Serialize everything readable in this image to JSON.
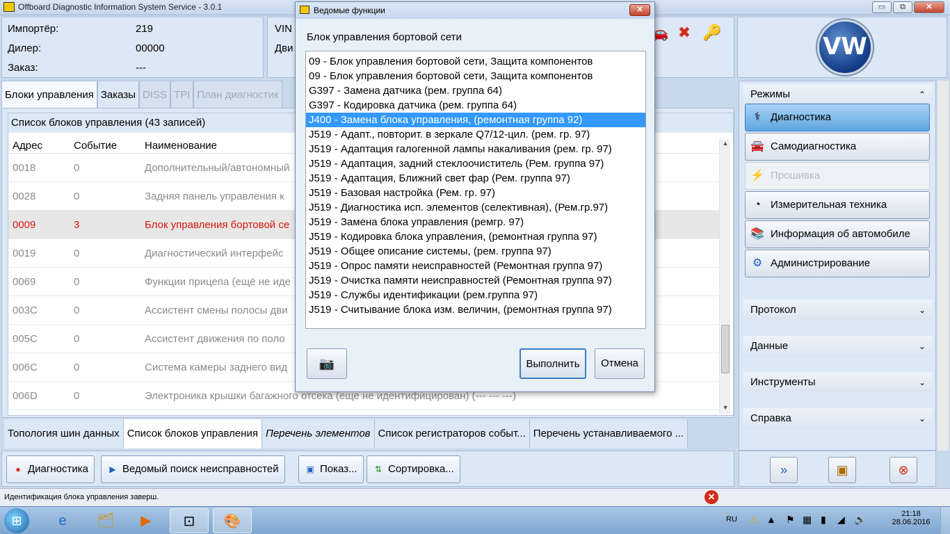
{
  "app": {
    "title": "Offboard Diagnostic Information System Service - 3.0.1",
    "win_min": "▭",
    "win_max": "⧉",
    "win_close": "✕"
  },
  "info": {
    "importer_label": "Импортёр:",
    "importer_value": "219",
    "dealer_label": "Дилер:",
    "dealer_value": "00000",
    "order_label": "Заказ:",
    "order_value": "---",
    "vin_label": "VIN",
    "dvi_label": "Дви"
  },
  "main_tabs": [
    {
      "label": "Блоки управления",
      "state": "active"
    },
    {
      "label": "Заказы",
      "state": "normal"
    },
    {
      "label": "DISS",
      "state": "disabled"
    },
    {
      "label": "TPI",
      "state": "disabled"
    },
    {
      "label": "План диагностик",
      "state": "disabled"
    }
  ],
  "control_units": {
    "title": "Список блоков управления (43 записей)",
    "headers": {
      "addr": "Адрес",
      "event": "Событие",
      "name": "Наименование"
    },
    "rows": [
      {
        "addr": "0018",
        "event": "0",
        "name": "Дополнительный/автономный"
      },
      {
        "addr": "0028",
        "event": "0",
        "name": "Задняя панель управления к"
      },
      {
        "addr": "0009",
        "event": "3",
        "name": "Блок управления бортовой се"
      },
      {
        "addr": "0019",
        "event": "0",
        "name": "Диагностический интерфейс"
      },
      {
        "addr": "0069",
        "event": "0",
        "name": "Функции прицепа (ещё не иде"
      },
      {
        "addr": "003C",
        "event": "0",
        "name": "Ассистент смены полосы дви"
      },
      {
        "addr": "005C",
        "event": "0",
        "name": "Ассистент движения по поло"
      },
      {
        "addr": "006C",
        "event": "0",
        "name": "Система камеры заднего вид"
      },
      {
        "addr": "006D",
        "event": "0",
        "name": "Электроника крышки багажного отсека (еще не идентифицирован) (---   ---   ---)"
      }
    ]
  },
  "bottom_tabs": [
    {
      "label": "Топология шин данных",
      "state": "normal"
    },
    {
      "label": "Список блоков управления",
      "state": "active"
    },
    {
      "label": "Перечень элементов",
      "state": "italic"
    },
    {
      "label": "Список регистраторов событ...",
      "state": "normal"
    },
    {
      "label": "Перечень устанавливаемого ...",
      "state": "normal"
    }
  ],
  "actions": {
    "diagnostics": "Диагностика",
    "guided_fault": "Ведомый поиск неисправностей",
    "show": "Показ...",
    "sort": "Сортировка..."
  },
  "status": {
    "text": "Идентификация блока управления заверш."
  },
  "right_panel": {
    "modes_label": "Режимы",
    "buttons": [
      {
        "label": "Диагностика",
        "state": "active",
        "icon": "stethoscope-icon"
      },
      {
        "label": "Самодиагностика",
        "state": "normal",
        "icon": "car-icon"
      },
      {
        "label": "Прошивка",
        "state": "disabled",
        "icon": "flash-icon"
      },
      {
        "label": "Измерительная техника",
        "state": "normal",
        "icon": "gauge-icon"
      },
      {
        "label": "Информация об автомобиле",
        "state": "normal",
        "icon": "books-icon"
      },
      {
        "label": "Администрирование",
        "state": "normal",
        "icon": "gear-icon"
      }
    ],
    "sections": [
      "Протокол",
      "Данные",
      "Инструменты",
      "Справка"
    ],
    "chev_up": "⌃",
    "chev_down": "⌄"
  },
  "dialog": {
    "title": "Ведомые функции",
    "heading": "Блок управления бортовой сети",
    "items": [
      "09 - Блок управления бортовой сети, Защита компонентов",
      "09 - Блок управления бортовой сети, Защита компонентов",
      "G397 - Замена датчика (рем. группа 64)",
      "G397 - Кодировка датчика (рем. группа 64)",
      "J400 - Замена блока управления, (ремонтная группа 92)",
      "J519 - Адапт., повторит. в зеркале Q7/12-цил. (рем. гр. 97)",
      "J519 - Адаптация галогенной лампы накаливания (рем. гр. 97)",
      "J519 - Адаптация,  задний стеклоочиститель (Рем. группа 97)",
      "J519 - Адаптация, Ближний свет фар (Рем. группа 97)",
      "J519 - Базовая настройка (Рем. гр. 97)",
      "J519 - Диагностика исп. элементов (селективная), (Рем.гр.97)",
      "J519 - Замена блока управления (ремгр. 97)",
      "J519 - Кодировка блока управления, (ремонтная группа 97)",
      "J519 - Общее описание системы, (рем. группа 97)",
      "J519 - Опрос памяти неисправностей (Ремонтная группа 97)",
      "J519 - Очистка памяти неисправностей (Ремонтная группа 97)",
      "J519 - Службы идентификации (рем.группа 97)",
      "J519 - Считывание блока изм. величин, (ремонтная группа 97)"
    ],
    "selected_index": 4,
    "execute": "Выполнить",
    "cancel": "Отмена",
    "close": "✕"
  },
  "taskbar": {
    "lang": "RU",
    "time": "21:18",
    "date": "28.06.2016"
  }
}
